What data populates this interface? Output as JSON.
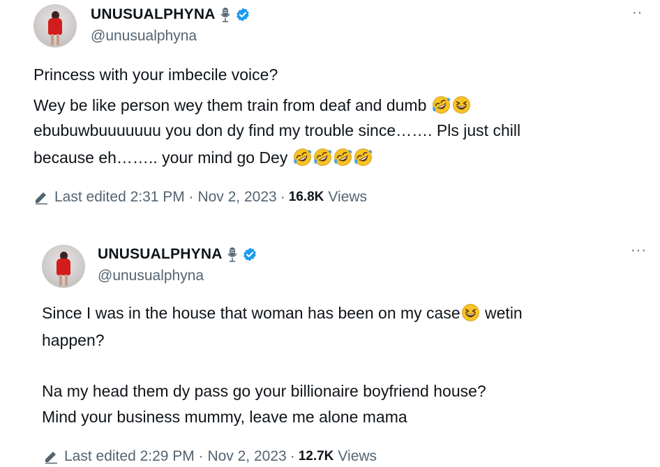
{
  "tweets": [
    {
      "display_name": "UNUSUALPHYNA",
      "handle": "@unusualphyna",
      "more_label": "··",
      "lines": [
        {
          "text": "Princess with your imbecile voice?",
          "emojis": []
        },
        {
          "text": "Wey be like person wey them train from deaf and dumb",
          "emojis": [
            "rofl",
            "grin"
          ]
        },
        {
          "text": "ebubuwbuuuuuuu you don dy find my trouble since……. Pls just chill",
          "emojis": []
        },
        {
          "text": "because eh…….. your mind go Dey",
          "emojis": [
            "rofl",
            "rofl",
            "rofl",
            "rofl"
          ]
        }
      ],
      "edited_label": "Last edited 2:31 PM · Nov 2, 2023",
      "separator": "·",
      "views_count": "16.8K",
      "views_label": "Views"
    },
    {
      "display_name": "UNUSUALPHYNA",
      "handle": "@unusualphyna",
      "more_label": "···",
      "lines": [
        {
          "text": "Since I was in the house that woman has been on my case",
          "emojis": [
            "grin"
          ],
          "tail": "wetin"
        },
        {
          "text": "happen?",
          "emojis": []
        },
        {
          "text": "Na my head them dy pass go your billionaire boyfriend house?",
          "emojis": []
        },
        {
          "text": "Mind your business mummy, leave me alone mama",
          "emojis": []
        }
      ],
      "edited_label": "Last edited 2:29 PM · Nov 2, 2023",
      "separator": "·",
      "views_count": "12.7K",
      "views_label": "Views"
    }
  ],
  "icons": {
    "verified_badge_color": "#1d9bf0",
    "mic": "microphone-icon",
    "edit": "pencil-icon",
    "emoji_rofl": "rolling-on-floor-laughing",
    "emoji_grin": "grinning-squinting-face"
  },
  "colors": {
    "text": "#0f1419",
    "secondary": "#536471",
    "emoji_yellow": "#f7c325",
    "emoji_tear": "#4aa3df"
  }
}
